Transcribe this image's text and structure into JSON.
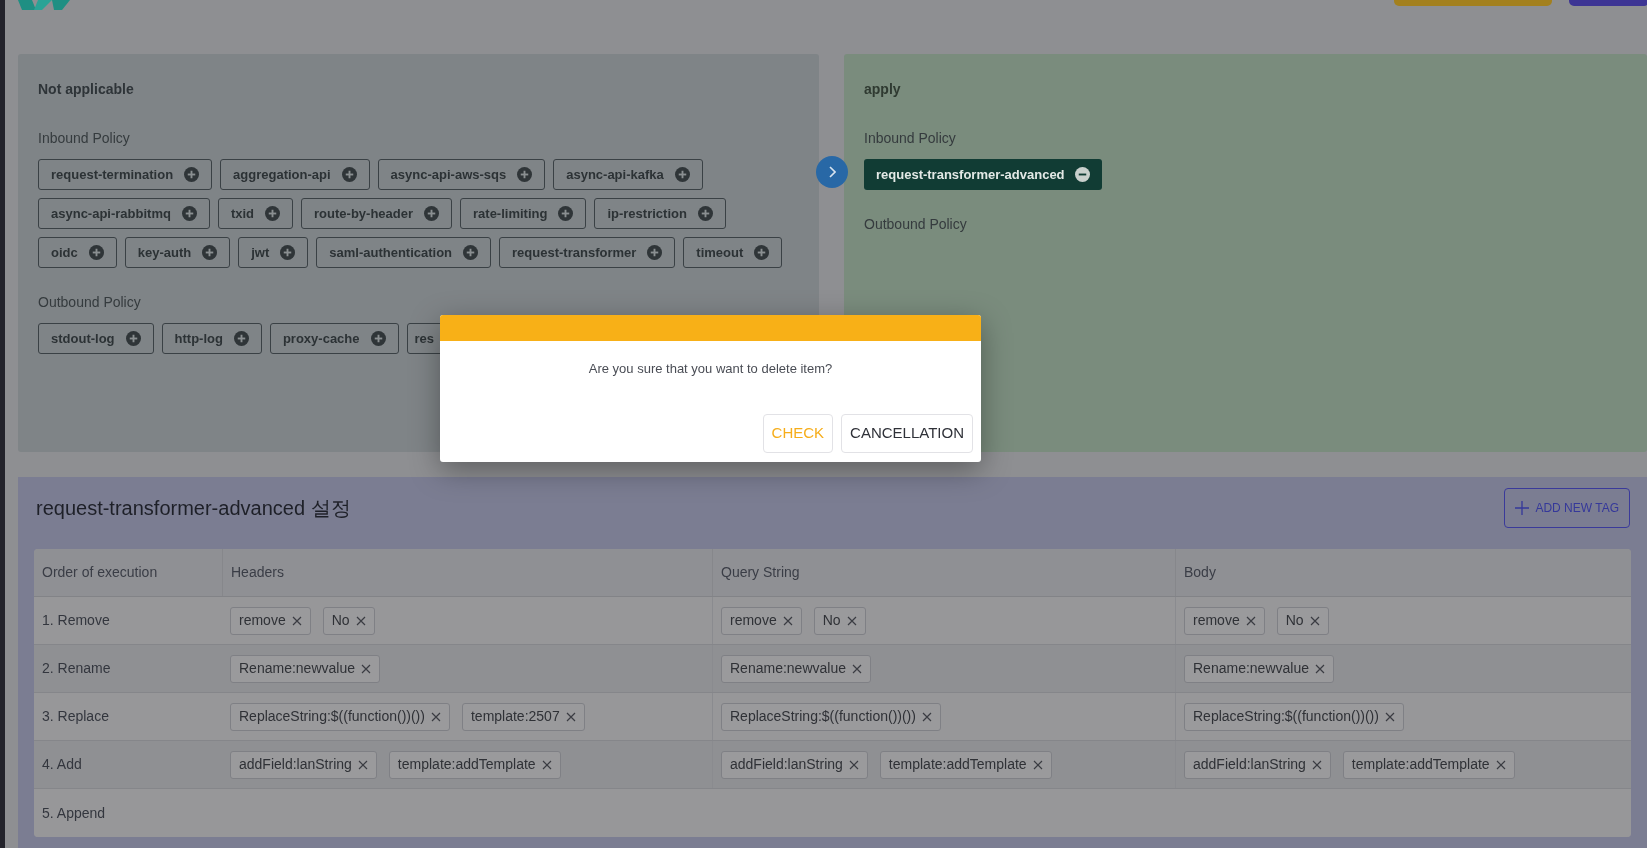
{
  "left_panel": {
    "title": "Not applicable",
    "sections": [
      {
        "heading": "Inbound Policy",
        "tags": [
          {
            "label": "request-termination",
            "kind": "add"
          },
          {
            "label": "aggregation-api",
            "kind": "add"
          },
          {
            "label": "async-api-aws-sqs",
            "kind": "add"
          },
          {
            "label": "async-api-kafka",
            "kind": "add"
          },
          {
            "label": "async-api-rabbitmq",
            "kind": "add"
          },
          {
            "label": "txid",
            "kind": "add"
          },
          {
            "label": "route-by-header",
            "kind": "add"
          },
          {
            "label": "rate-limiting",
            "kind": "add"
          },
          {
            "label": "ip-restriction",
            "kind": "add"
          },
          {
            "label": "oidc",
            "kind": "add"
          },
          {
            "label": "key-auth",
            "kind": "add"
          },
          {
            "label": "jwt",
            "kind": "add"
          },
          {
            "label": "saml-authentication",
            "kind": "add"
          },
          {
            "label": "request-transformer",
            "kind": "add"
          },
          {
            "label": "timeout",
            "kind": "add"
          }
        ]
      },
      {
        "heading": "Outbound Policy",
        "tags": [
          {
            "label": "stdout-log",
            "kind": "add"
          },
          {
            "label": "http-log",
            "kind": "add"
          },
          {
            "label": "proxy-cache",
            "kind": "add"
          },
          {
            "label": "res",
            "kind": "cut"
          }
        ]
      }
    ]
  },
  "right_panel": {
    "title": "apply",
    "sections": [
      {
        "heading": "Inbound Policy",
        "tags": [
          {
            "label": "request-transformer-advanced",
            "kind": "remove"
          }
        ]
      },
      {
        "heading": "Outbound Policy"
      }
    ]
  },
  "dialog": {
    "message": "Are you sure that you want to delete item?",
    "buttons": [
      {
        "label": "CHECK",
        "kind": "primary"
      },
      {
        "label": "CANCELLATION",
        "kind": "secondary"
      }
    ]
  },
  "settings": {
    "title": "request-transformer-advanced 설정",
    "add_button": "ADD NEW TAG",
    "columns": [
      "Order of execution",
      "Headers",
      "Query String",
      "Body"
    ],
    "rows": [
      {
        "cells": [
          "1. Remove",
          [
            "remove",
            "No"
          ],
          [
            "remove",
            "No"
          ],
          [
            "remove",
            "No"
          ]
        ]
      },
      {
        "cells": [
          "2. Rename",
          [
            "Rename:newvalue"
          ],
          [
            "Rename:newvalue"
          ],
          [
            "Rename:newvalue"
          ]
        ]
      },
      {
        "cells": [
          "3. Replace",
          [
            "ReplaceString:$((function())())",
            "template:2507"
          ],
          [
            "ReplaceString:$((function())())"
          ],
          [
            "ReplaceString:$((function())())"
          ]
        ]
      },
      {
        "cells": [
          "4. Add",
          [
            "addField:lanString",
            "template:addTemplate"
          ],
          [
            "addField:lanString",
            "template:addTemplate"
          ],
          [
            "addField:lanString",
            "template:addTemplate"
          ]
        ]
      },
      {
        "cells": [
          "5. Append",
          "",
          "",
          ""
        ]
      }
    ]
  }
}
